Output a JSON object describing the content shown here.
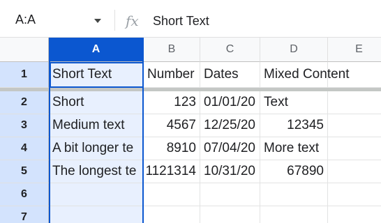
{
  "name_box": {
    "value": "A:A",
    "arrow_icon": "caret-down-icon"
  },
  "formula_bar": {
    "icon": "fx-icon",
    "icon_text": "fx",
    "value": "Short Text"
  },
  "columns": [
    {
      "letter": "A",
      "selected": true
    },
    {
      "letter": "B",
      "selected": false
    },
    {
      "letter": "C",
      "selected": false
    },
    {
      "letter": "D",
      "selected": false
    },
    {
      "letter": "E",
      "selected": false
    }
  ],
  "rows": [
    {
      "number": "1",
      "cells": [
        "Short Text",
        "Number",
        "Dates",
        "Mixed Content",
        ""
      ]
    },
    {
      "number": "2",
      "cells": [
        "Short",
        "123",
        "01/01/20",
        "Text",
        ""
      ]
    },
    {
      "number": "3",
      "cells": [
        "Medium text",
        "4567",
        "12/25/20",
        "12345",
        ""
      ]
    },
    {
      "number": "4",
      "cells": [
        "A bit longer te",
        "8910",
        "07/04/20",
        "More text",
        ""
      ]
    },
    {
      "number": "5",
      "cells": [
        "The longest te",
        "1121314",
        "10/31/20",
        "67890",
        ""
      ]
    },
    {
      "number": "6",
      "cells": [
        "",
        "",
        "",
        "",
        ""
      ]
    },
    {
      "number": "7",
      "cells": [
        "",
        "",
        "",
        "",
        ""
      ]
    }
  ],
  "colors": {
    "selection": "#0b57d0",
    "selected_column_fill": "#e8f0fe",
    "selected_row_header_fill": "#d3e3fd"
  }
}
